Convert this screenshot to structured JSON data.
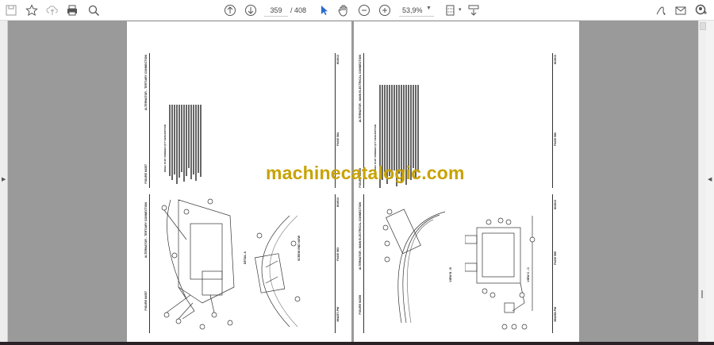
{
  "toolbar": {
    "left_icons": [
      "save-icon",
      "bookmark-star-icon",
      "upload-cloud-icon",
      "print-icon",
      "search-zoom-icon"
    ],
    "current_page": "359",
    "total_pages": "/ 408",
    "zoom": "53,9%",
    "right_icons": [
      "sign-pen-icon",
      "email-icon",
      "add-user-icon"
    ]
  },
  "document": {
    "watermark": "machinecatalogic.com",
    "left_sheet": {
      "figure_a": "FIGURE 84357",
      "title_a": "ALTERNATOR - TERTIARY CONNECTION",
      "figure_b": "FIGURE 84357",
      "title_b": "ALTERNATOR - TERTIARY CONNECTION",
      "list_header": "INDEX   PART NUMBER   QTY   DESCRIPTION",
      "detail_label": "DETAIL A",
      "view_label": "SCREW END VIEW",
      "footer_doc": "984257-PM",
      "footer_page_a": "PAGE 583",
      "footer_page_b": "PAGE 584",
      "footer_date": "8/19/13"
    },
    "right_sheet": {
      "figure_a": "FIGURE 84358",
      "title_a": "ALTERNATOR - MAIN ELECTRICAL CONNECTION",
      "figure_b": "FIGURE 84358",
      "title_b": "ALTERNATOR - MAIN ELECTRICAL CONNECTION",
      "list_header": "INDEX   PART NUMBER   QTY   DESCRIPTION",
      "view_b": "VIEW B - B",
      "view_c": "VIEW C - C",
      "footer_doc": "984258-PM",
      "footer_page_a": "PAGE 585",
      "footer_page_b": "PAGE 586",
      "footer_date": "8/19/13"
    }
  }
}
